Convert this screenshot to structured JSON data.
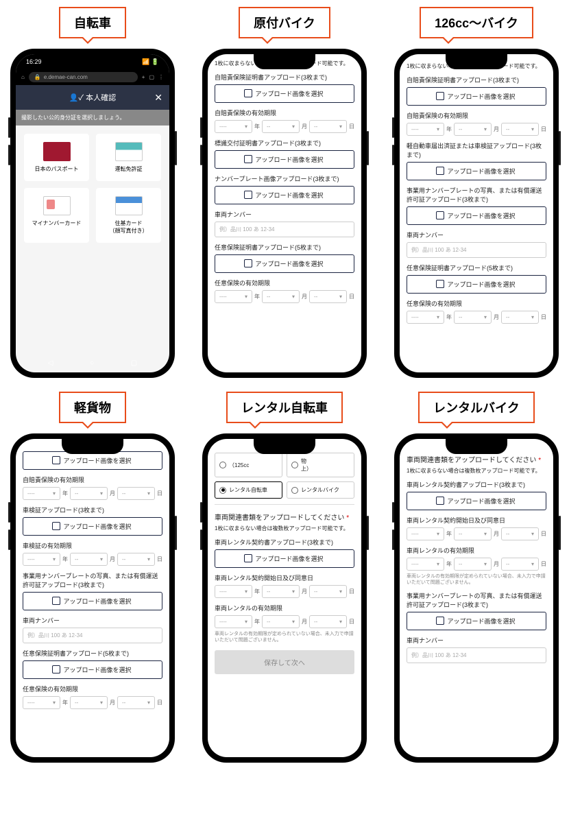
{
  "labels": [
    "自転車",
    "原付バイク",
    "126cc～バイク",
    "軽貨物",
    "レンタル自転車",
    "レンタルバイク"
  ],
  "common": {
    "upload_btn": "アップロード画像を選択",
    "multi_note": "1枚に収まらない場合は複数枚アップロード可能です。",
    "year": "年",
    "month": "月",
    "day": "日",
    "dash": "----",
    "dash2": "--",
    "vehicle_num_label": "車両ナンバー",
    "vehicle_num_ph": "例）品川 100 あ 12-34",
    "save_next": "保存して次へ",
    "rental_help": "車両レンタルの有効期限が定められていない場合、未入力で申請いただいて問題ございません。"
  },
  "p1": {
    "time": "16:29",
    "url": "e.demae-can.com",
    "title": "本人確認",
    "info": "撮影したい公的身分証を選択しましょう。",
    "ids": [
      "日本のパスポート",
      "運転免許証",
      "マイナンバーカード",
      "住基カード\n（顔写真付き）"
    ]
  },
  "p2": {
    "f1": "自賠責保険証明書アップロード(3枚まで)",
    "f2": "自賠責保険の有効期限",
    "f3": "標識交付証明書アップロード(3枚まで)",
    "f4": "ナンバープレート画像アップロード(3枚まで)",
    "f5": "任意保険証明書アップロード(5枚まで)",
    "f6": "任意保険の有効期限"
  },
  "p3": {
    "f1": "自賠責保険証明書アップロード(3枚まで)",
    "f2": "自賠責保険の有効期限",
    "f3": "軽自動車届出済証または車検証アップロード(3枚まで)",
    "f4": "事業用ナンバープレートの写真、または有償運送許可証アップロード(3枚まで)",
    "f5": "任意保険証明書アップロード(5枚まで)",
    "f6": "任意保険の有効期限"
  },
  "p4": {
    "f1": "自賠責保険の有効期限",
    "f2": "車検証アップロード(3枚まで)",
    "f3": "車検証の有効期限",
    "f4": "事業用ナンバープレートの写真、または有償運送許可証アップロード(3枚まで)",
    "f5": "任意保険証明書アップロード(5枚まで)",
    "f6": "任意保険の有効期限"
  },
  "p5": {
    "opt_125": "（125cc",
    "opt_unk": "物\n上）",
    "opt_rbike": "レンタル自転車",
    "opt_rmoto": "レンタルバイク",
    "section": "車両関連書類をアップロードしてください",
    "f1": "車両レンタル契約書アップロード(3枚まで)",
    "f2": "車両レンタル契約開始日及び同意日",
    "f3": "車両レンタルの有効期限"
  },
  "p6": {
    "section": "車両関連書類をアップロードしてください",
    "f1": "車両レンタル契約書アップロード(3枚まで)",
    "f2": "車両レンタル契約開始日及び同意日",
    "f3": "車両レンタルの有効期限",
    "f4": "事業用ナンバープレートの写真、または有償運送許可証アップロード(3枚まで)"
  }
}
